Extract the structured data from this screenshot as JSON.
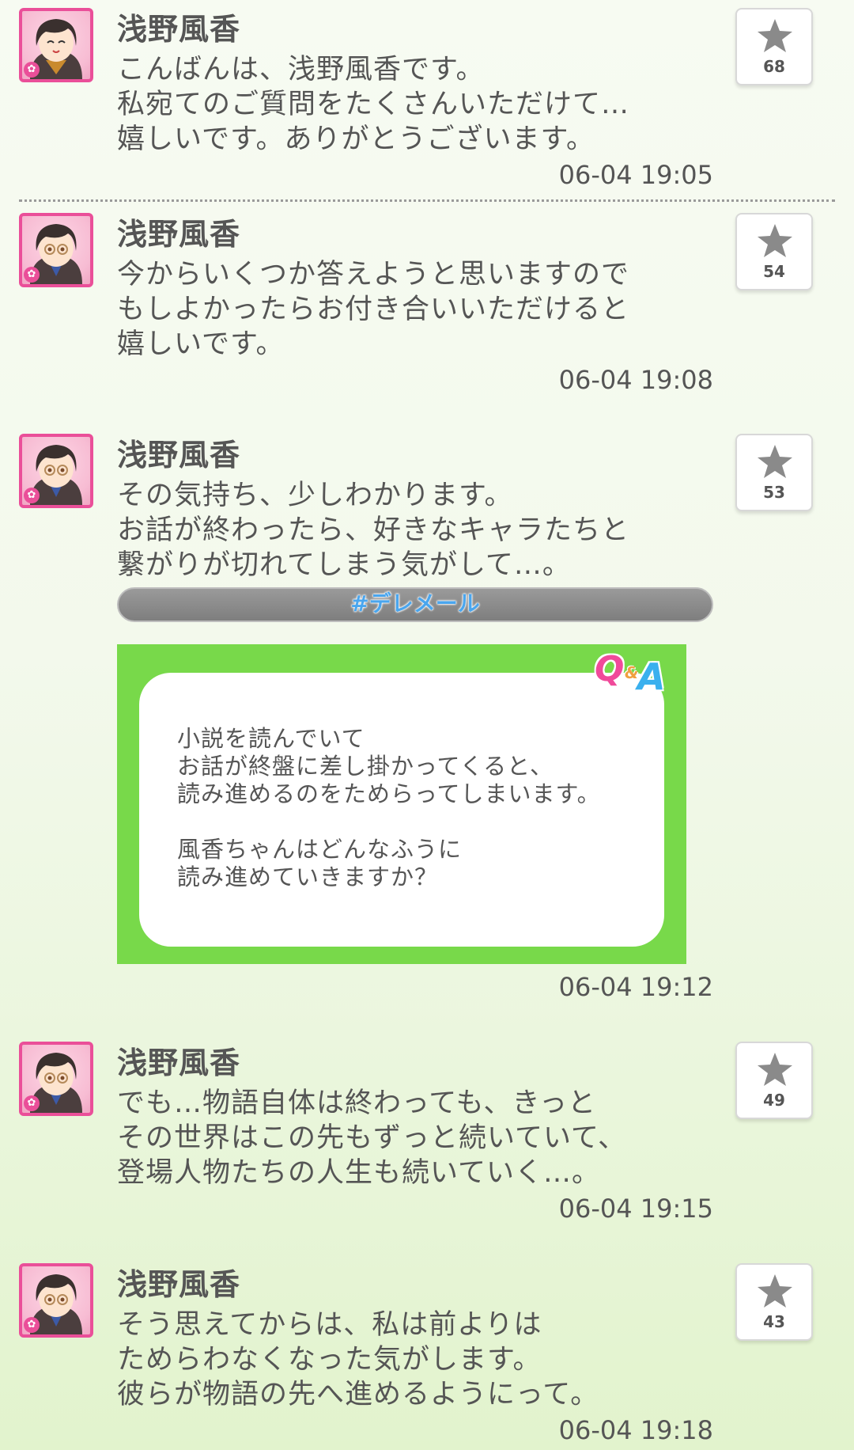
{
  "posts": [
    {
      "author": "浅野風香",
      "message": "こんばんは、浅野風香です。\n私宛てのご質問をたくさんいただけて…\n嬉しいです。ありがとうございます。",
      "time": "06-04 19:05",
      "favorites": "68"
    },
    {
      "author": "浅野風香",
      "message": "今からいくつか答えようと思いますので\nもしよかったらお付き合いいただけると\n嬉しいです。",
      "time": "06-04 19:08",
      "favorites": "54"
    },
    {
      "author": "浅野風香",
      "message": "その気持ち、少しわかります。\nお話が終わったら、好きなキャラたちと\n繋がりが切れてしまう気がして…。",
      "hashtag": "#デレメール",
      "qa_logo": {
        "q": "Q",
        "amp": "&",
        "a": "A"
      },
      "qa_text": "小説を読んでいて\nお話が終盤に差し掛かってくると、\n読み進めるのをためらってしまいます。\n\n風香ちゃんはどんなふうに\n読み進めていきますか？",
      "time": "06-04 19:12",
      "favorites": "53"
    },
    {
      "author": "浅野風香",
      "message": "でも…物語自体は終わっても、きっと\nその世界はこの先もずっと続いていて、\n登場人物たちの人生も続いていく…。",
      "time": "06-04 19:15",
      "favorites": "49"
    },
    {
      "author": "浅野風香",
      "message": "そう思えてからは、私は前よりは\nためらわなくなった気がします。\n彼らが物語の先へ進めるようにって。",
      "time": "06-04 19:18",
      "favorites": "43"
    }
  ],
  "colors": {
    "avatar_border": "#ea4f99",
    "qa_green": "#78d94a",
    "hashtag_blue": "#4aa6ee",
    "text": "#555555"
  },
  "icons": [
    "avatar-image",
    "star-icon",
    "flower-badge-icon"
  ]
}
